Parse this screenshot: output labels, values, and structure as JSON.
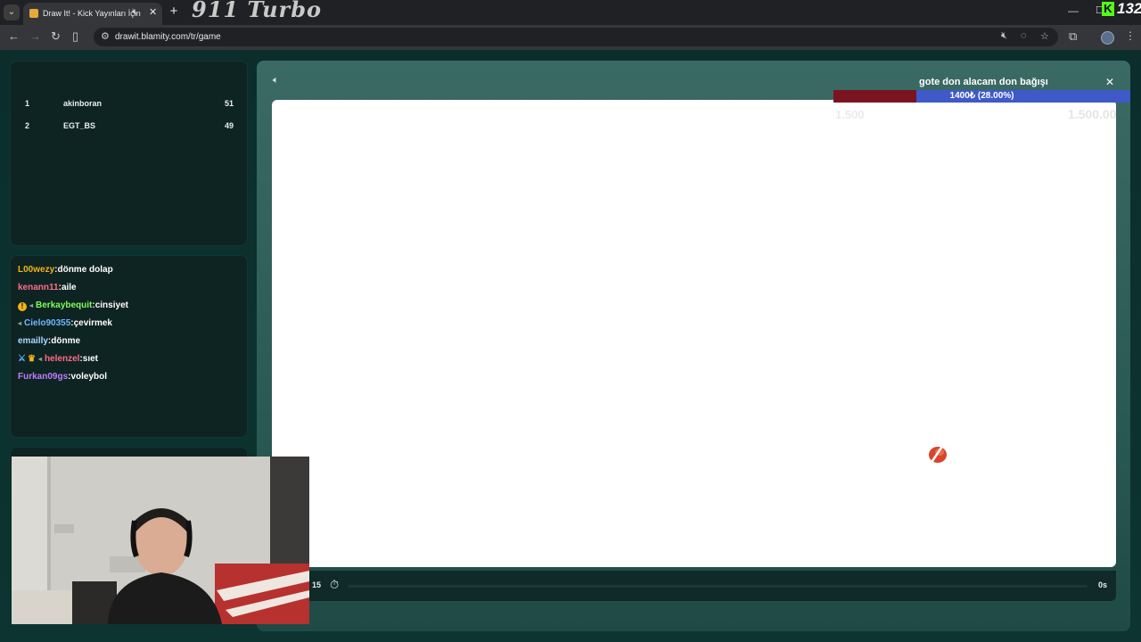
{
  "browser": {
    "tab": {
      "title": "Draw It! - Kick Yayınları İçin",
      "mute_icon": "muted-speaker-icon",
      "close_icon": "close-icon"
    },
    "new_tab_icon": "plus-icon",
    "logo_text": "911 Turbo",
    "kick_count": "132",
    "url": "drawit.blamity.com/tr/game"
  },
  "leaderboard": {
    "rows": [
      {
        "rank": "1",
        "name": "akinboran",
        "score": "51"
      },
      {
        "rank": "2",
        "name": "EGT_BS",
        "score": "49"
      }
    ]
  },
  "chat": {
    "messages": [
      {
        "user": "L00wezy",
        "text": "dönme dolap",
        "color": "#f2b417"
      },
      {
        "user": "kenann11",
        "text": "aile",
        "color": "#ff6b8a"
      },
      {
        "user": "Berkaybequit",
        "text": "cinsiyet",
        "color": "#7dff5a"
      },
      {
        "user": "Cielo90355",
        "text": "çevirmek",
        "color": "#6fb6ff"
      },
      {
        "user": "emailly",
        "text": "dönme",
        "color": "#a9d8ff"
      },
      {
        "user": "helenzel",
        "text": "sıet",
        "color": "#ff6b8a"
      },
      {
        "user": "Furkan09gs",
        "text": "voleybol",
        "color": "#c07bff"
      }
    ]
  },
  "game": {
    "round": "15",
    "time_left": "0s"
  },
  "donation": {
    "title": "gote don alacam don bağışı",
    "progress_text": "1400₺ (28.00%)",
    "progress_fraction": 0.28,
    "min_label": "1.500",
    "max_label": "1.500.00"
  },
  "colors": {
    "accent_kick": "#53fc18",
    "donation_fill": "#7a1420",
    "donation_bg": "#3f59c9"
  }
}
